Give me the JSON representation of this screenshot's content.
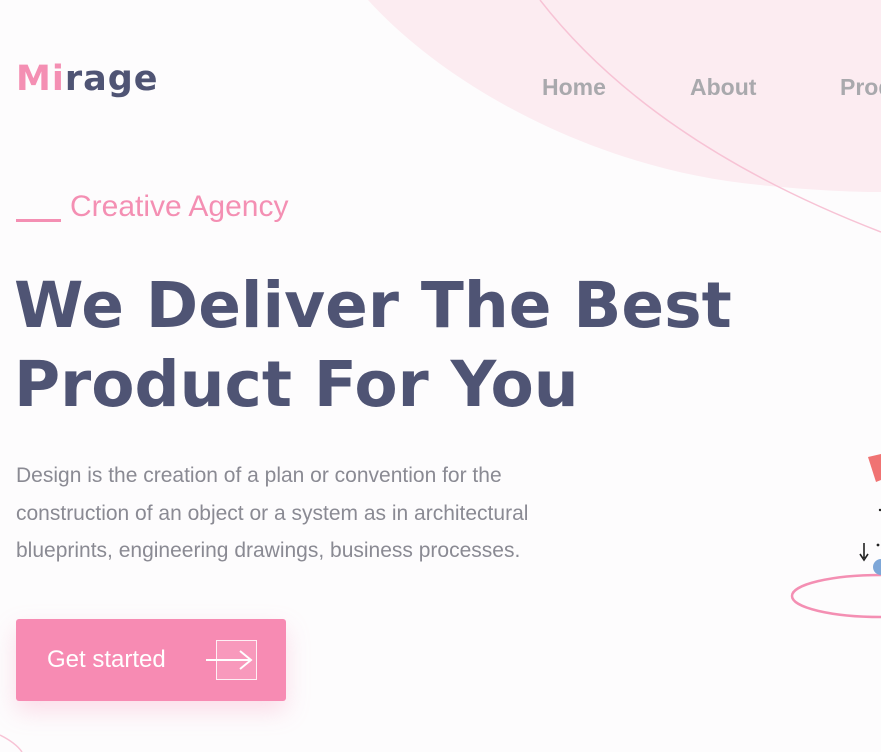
{
  "brand": {
    "logo_prefix": "Mi",
    "logo_suffix": "rage"
  },
  "nav": {
    "items": [
      {
        "label": "Home"
      },
      {
        "label": "About"
      },
      {
        "label": "Prod"
      }
    ]
  },
  "hero": {
    "eyebrow": "Creative Agency",
    "headline_line1": "We Deliver The Best",
    "headline_line2": "Product For You",
    "description": "Design is the creation of a plan or convention for the construction of an object or a system as in architectural blueprints, engineering drawings, business processes.",
    "cta_label": "Get started"
  },
  "icons": {
    "cta_icon": "arrow-right-icon"
  },
  "colors": {
    "accent": "#f48fb3",
    "cta_bg": "#f78bb3",
    "heading": "#4f5474",
    "body_text": "#8a8a93",
    "nav_text": "#a9a9ad",
    "blob": "#fcecf1"
  }
}
